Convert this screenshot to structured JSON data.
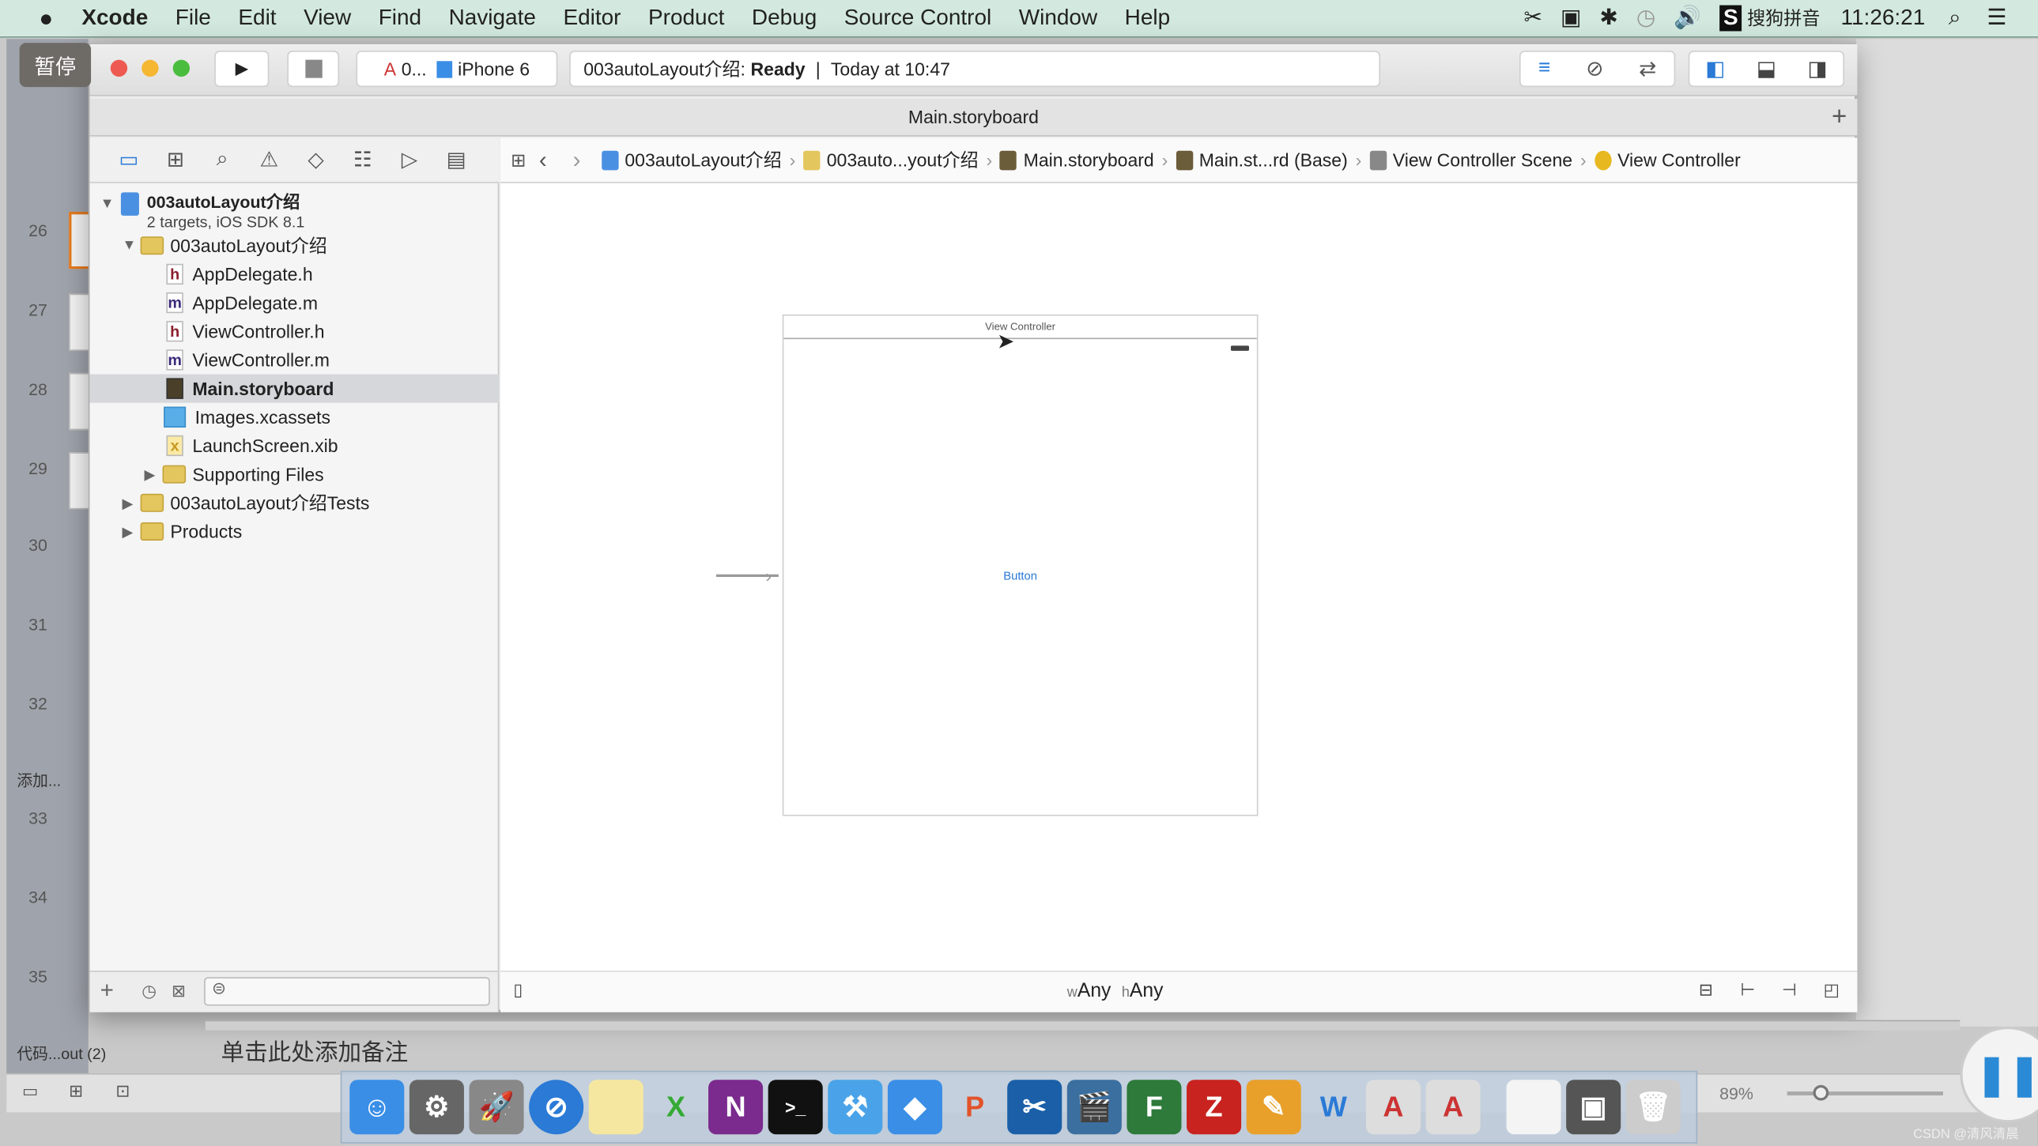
{
  "menubar": {
    "app": "Xcode",
    "items": [
      "File",
      "Edit",
      "View",
      "Find",
      "Navigate",
      "Editor",
      "Product",
      "Debug",
      "Source Control",
      "Window",
      "Help"
    ],
    "input_method": "搜狗拼音",
    "clock": "11:26:21"
  },
  "overlay": {
    "pause_label": "暂停"
  },
  "toolbar": {
    "scheme": "0...",
    "device": "iPhone 6",
    "status_project": "003autoLayout介绍:",
    "status_state": "Ready",
    "status_time": "Today at 10:47"
  },
  "tab": {
    "title": "Main.storyboard"
  },
  "jumpbar": [
    "003autoLayout介绍",
    "003auto...yout介绍",
    "Main.storyboard",
    "Main.st...rd (Base)",
    "View Controller Scene",
    "View Controller"
  ],
  "navigator": {
    "project": {
      "name": "003autoLayout介绍",
      "subtitle": "2 targets, iOS SDK 8.1"
    },
    "items": [
      {
        "label": "003autoLayout介绍",
        "type": "folder",
        "disclosure": "open"
      },
      {
        "label": "AppDelegate.h",
        "type": "h"
      },
      {
        "label": "AppDelegate.m",
        "type": "m"
      },
      {
        "label": "ViewController.h",
        "type": "h"
      },
      {
        "label": "ViewController.m",
        "type": "m"
      },
      {
        "label": "Main.storyboard",
        "type": "storyboard",
        "selected": true
      },
      {
        "label": "Images.xcassets",
        "type": "xcassets"
      },
      {
        "label": "LaunchScreen.xib",
        "type": "xib"
      },
      {
        "label": "Supporting Files",
        "type": "folder",
        "disclosure": "closed"
      },
      {
        "label": "003autoLayout介绍Tests",
        "type": "folder",
        "disclosure": "closed"
      },
      {
        "label": "Products",
        "type": "folder",
        "disclosure": "closed"
      }
    ]
  },
  "scene": {
    "title": "View Controller",
    "button_label": "Button"
  },
  "size_class": {
    "w_prefix": "w",
    "w": "Any",
    "h_prefix": "h",
    "h": "Any"
  },
  "ppt": {
    "slide_numbers": [
      "26",
      "27",
      "28",
      "29",
      "30",
      "31",
      "32",
      "33",
      "34",
      "35"
    ],
    "section_add": "添加...",
    "section_code": "代码...out (2)",
    "notes_placeholder": "单击此处添加备注",
    "zoom": "89%"
  },
  "watermark": "CSDN @清风清晨",
  "colors": {
    "menubar": "#d3e9df",
    "selection": "#d6d7db",
    "accent": "#2a7ad6"
  }
}
